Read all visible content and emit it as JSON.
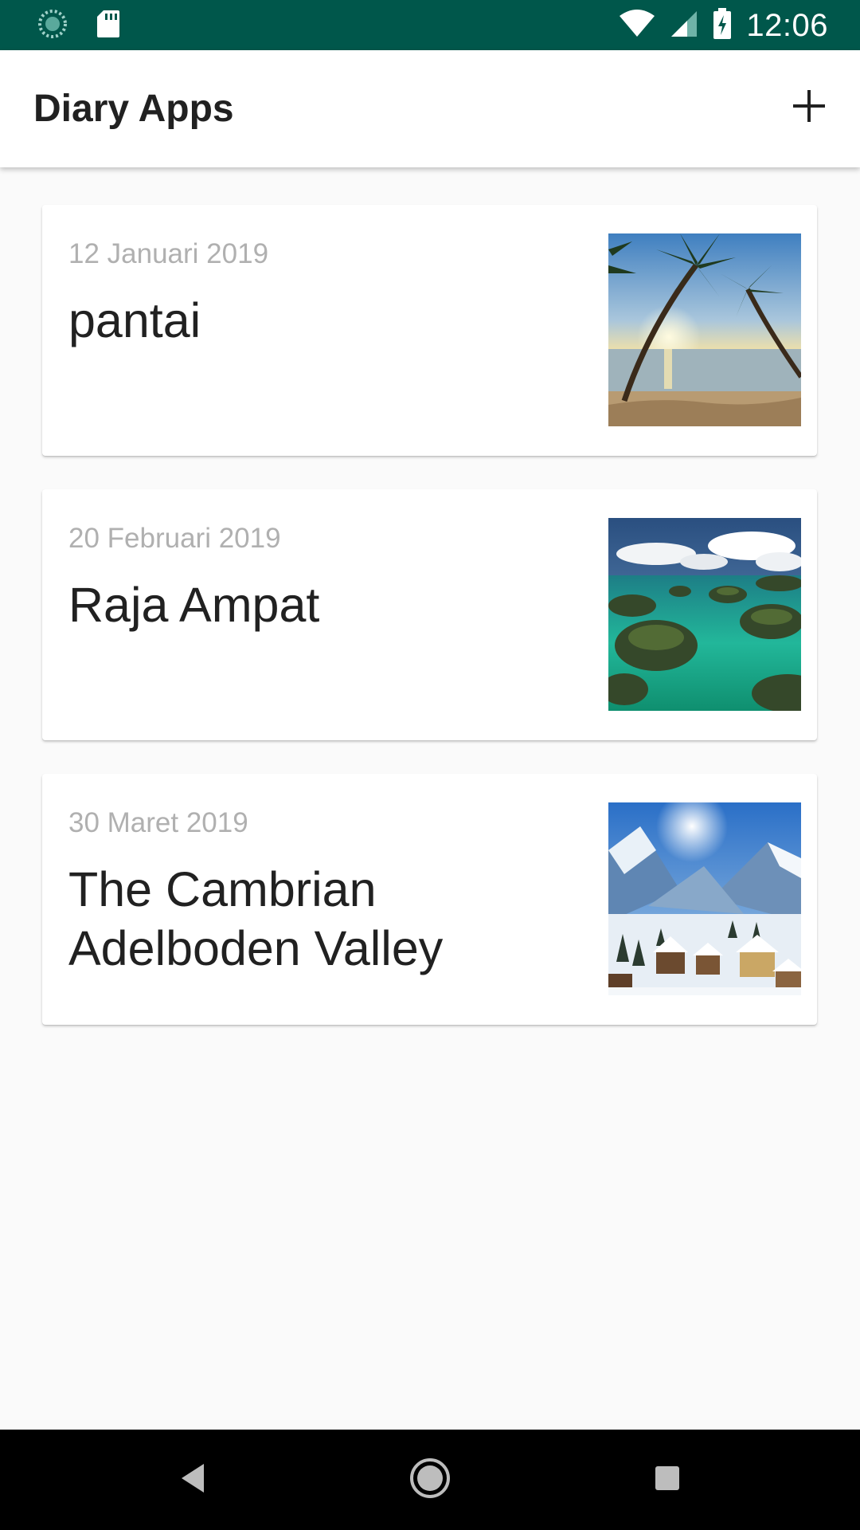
{
  "status_bar": {
    "time": "12:06",
    "left_icons": [
      "loading-icon",
      "sd-card-icon"
    ],
    "right_icons": [
      "wifi-icon",
      "cellular-signal-icon",
      "battery-charging-icon"
    ],
    "background_color": "#00574b"
  },
  "app_bar": {
    "title": "Diary Apps",
    "action_icon": "add-icon"
  },
  "entries": [
    {
      "date": "12 Januari 2019",
      "title": "pantai",
      "thumbnail": "beach-sunset-image"
    },
    {
      "date": "20 Februari 2019",
      "title": "Raja Ampat",
      "thumbnail": "tropical-islands-image"
    },
    {
      "date": "30 Maret 2019",
      "title": "The Cambrian Adelboden Valley",
      "thumbnail": "snowy-mountain-village-image"
    }
  ],
  "nav_bar": {
    "buttons": [
      "back-icon",
      "home-icon",
      "recents-icon"
    ]
  }
}
